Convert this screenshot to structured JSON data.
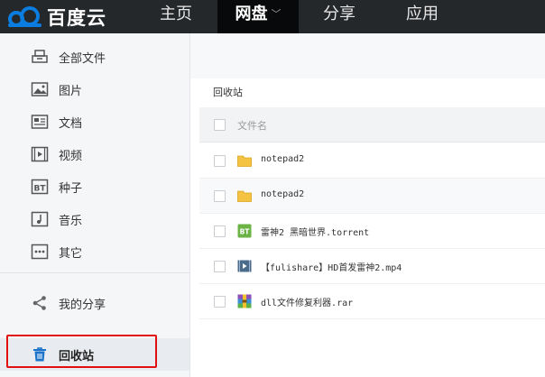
{
  "topbar": {
    "logo_text": "百度云",
    "nav": [
      {
        "label": "主页"
      },
      {
        "label": "网盘",
        "active": true
      },
      {
        "label": "分享"
      },
      {
        "label": "应用"
      }
    ]
  },
  "sidebar": {
    "items": [
      {
        "label": "全部文件",
        "icon": "all-files-icon"
      },
      {
        "label": "图片",
        "icon": "picture-icon"
      },
      {
        "label": "文档",
        "icon": "document-icon"
      },
      {
        "label": "视频",
        "icon": "video-icon"
      },
      {
        "label": "种子",
        "icon": "torrent-icon"
      },
      {
        "label": "音乐",
        "icon": "music-icon"
      },
      {
        "label": "其它",
        "icon": "other-icon"
      }
    ],
    "share": {
      "label": "我的分享",
      "icon": "share-icon"
    },
    "recycle": {
      "label": "回收站",
      "icon": "trash-icon"
    }
  },
  "main": {
    "breadcrumb": "回收站",
    "list_header": "文件名",
    "files": [
      {
        "name": "notepad2",
        "type": "folder"
      },
      {
        "name": "notepad2",
        "type": "folder"
      },
      {
        "name": "雷神2 黑暗世界.torrent",
        "type": "torrent",
        "icon_text": "BT"
      },
      {
        "name": "【fulishare】HD首发雷神2.mp4",
        "type": "video"
      },
      {
        "name": "dll文件修复利器.rar",
        "type": "archive"
      }
    ]
  },
  "colors": {
    "topbar": "#25282b",
    "nav_active": "#08090a",
    "sidebar": "#f5f6f8",
    "highlight": "#e01010",
    "brand_blue": "#0b7de0",
    "trash_blue": "#1a72c9",
    "folder": "#f5c342",
    "torrent": "#6ab344"
  }
}
